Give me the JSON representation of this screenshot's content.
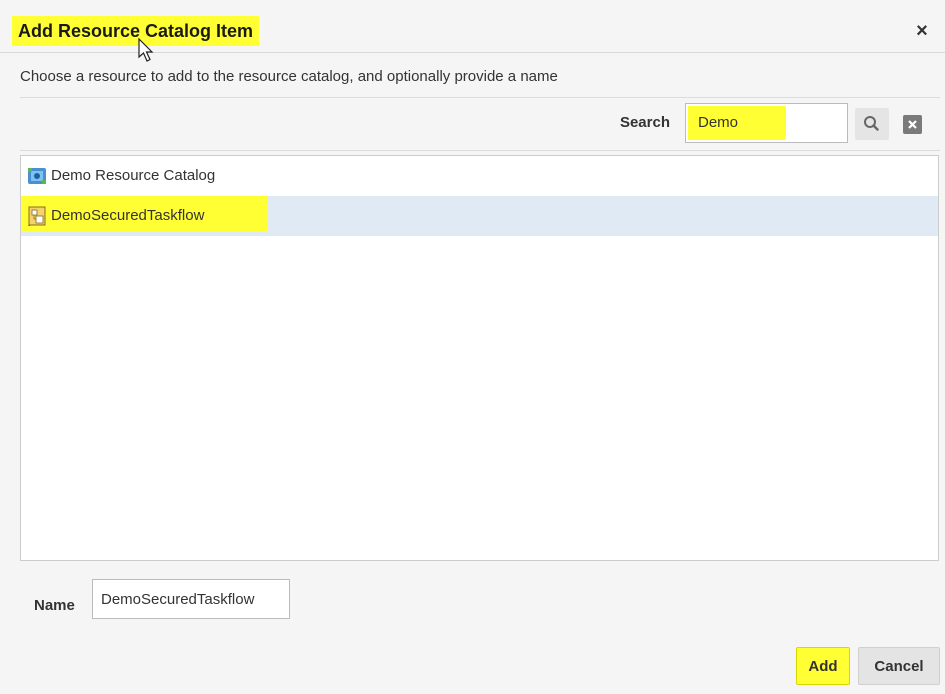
{
  "dialog": {
    "title": "Add Resource Catalog Item",
    "close_glyph": "×",
    "instructions": "Choose a resource to add to the resource catalog, and optionally provide a name"
  },
  "search": {
    "label": "Search",
    "value": "Demo",
    "search_icon": "search-icon",
    "clear_icon": "clear-icon"
  },
  "results": [
    {
      "label": "Demo Resource Catalog",
      "icon": "resource-catalog-icon",
      "selected": false
    },
    {
      "label": "DemoSecuredTaskflow",
      "icon": "taskflow-icon",
      "selected": true
    }
  ],
  "name_field": {
    "label": "Name",
    "value": "DemoSecuredTaskflow"
  },
  "buttons": {
    "add": "Add",
    "cancel": "Cancel"
  },
  "colors": {
    "highlight": "#ffff33",
    "selected_row": "#dfeaf5"
  }
}
